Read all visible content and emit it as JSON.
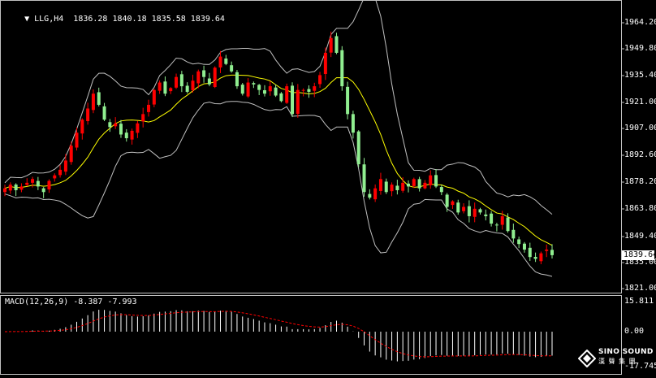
{
  "window": {
    "symbol_header": "LLG,H4  1836.28 1840.18 1835.58 1839.64",
    "current_price_label": "1839.64"
  },
  "indicator": {
    "header": "MACD(12,26,9) -8.387 -7.993",
    "axis_labels": [
      "15.811",
      "0.00",
      "-17.745"
    ]
  },
  "brand": {
    "name": "SINO SOUND",
    "subtitle": "漢 聲 集 團"
  },
  "colors": {
    "background": "#000000",
    "bull_candle": "#ff0000",
    "bear_candle": "#90ee90",
    "bollinger": "#c0c0c0",
    "ma": "#ffff00",
    "macd_hist": "#ffffff",
    "macd_signal": "#ff0000",
    "grid_border": "#c0c0c0"
  },
  "chart_data": {
    "type": "candlestick",
    "price_axis": {
      "ticks": [
        "1964.20",
        "1949.80",
        "1935.40",
        "1921.00",
        "1907.00",
        "1892.60",
        "1878.20",
        "1863.80",
        "1849.40",
        "1835.00",
        "1821.00"
      ],
      "ylim": [
        1821.0,
        1969.0
      ]
    },
    "close_path": [
      1875,
      1877,
      1874,
      1876,
      1878,
      1880,
      1876,
      1873,
      1879,
      1882,
      1885,
      1890,
      1898,
      1905,
      1912,
      1918,
      1926,
      1920,
      1912,
      1908,
      1910,
      1904,
      1902,
      1906,
      1910,
      1915,
      1920,
      1928,
      1932,
      1926,
      1929,
      1935,
      1930,
      1927,
      1933,
      1938,
      1935,
      1931,
      1940,
      1946,
      1942,
      1938,
      1930,
      1926,
      1932,
      1931,
      1928,
      1926,
      1930,
      1925,
      1922,
      1930,
      1915,
      1928,
      1928,
      1927,
      1930,
      1936,
      1948,
      1956,
      1948,
      1930,
      1915,
      1905,
      1888,
      1873,
      1870,
      1875,
      1880,
      1873,
      1877,
      1874,
      1878,
      1876,
      1880,
      1875,
      1878,
      1882,
      1876,
      1873,
      1865,
      1868,
      1862,
      1865,
      1860,
      1864,
      1862,
      1860,
      1856,
      1855,
      1860,
      1852,
      1848,
      1845,
      1842,
      1838,
      1837,
      1840,
      1842,
      1839
    ],
    "macd_ylim": [
      -17.745,
      15.811
    ]
  }
}
